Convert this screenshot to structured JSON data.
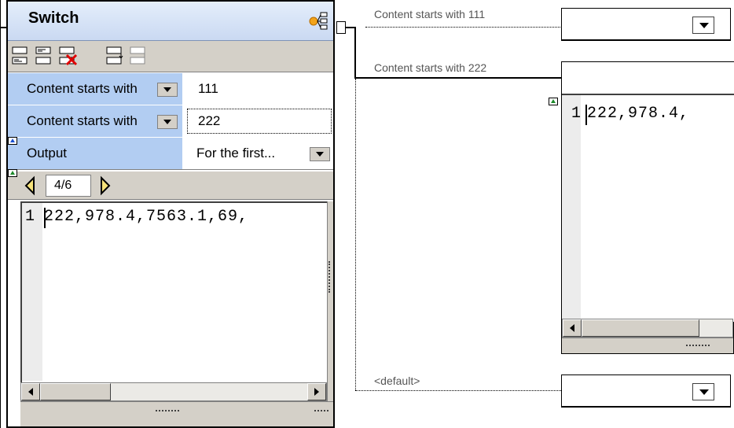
{
  "switch": {
    "title": "Switch",
    "rows": [
      {
        "label": "Content starts with",
        "value": "111"
      },
      {
        "label": "Content starts with",
        "value": "222"
      },
      {
        "label": "Output",
        "value": "For the first..."
      }
    ],
    "pager": {
      "value": "4/6"
    },
    "preview": {
      "line_number": "1",
      "text": "222,978.4,7563.1,69,"
    }
  },
  "connectors": {
    "case1": "Content starts with 111",
    "case2": "Content starts with 222",
    "default": "<default>"
  },
  "right_preview": {
    "line_number": "1",
    "text": "222,978.4,"
  },
  "colors": {
    "row_label_bg": "#b2cdf2",
    "toolbar_bg": "#d4d0c8",
    "header_bg": "#cad9f2"
  }
}
